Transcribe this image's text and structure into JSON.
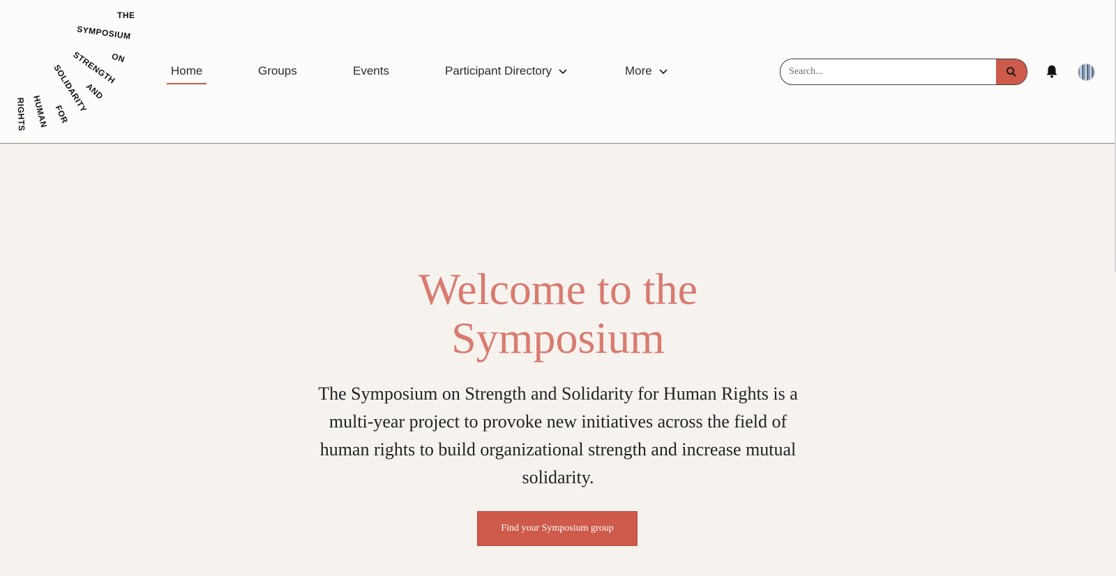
{
  "logo": {
    "words": [
      "THE",
      "SYMPOSIUM",
      "ON",
      "STRENGTH",
      "AND",
      "SOLIDARITY",
      "FOR",
      "HUMAN",
      "RIGHTS"
    ]
  },
  "nav": {
    "items": [
      {
        "label": "Home",
        "active": true
      },
      {
        "label": "Groups"
      },
      {
        "label": "Events"
      },
      {
        "label": "Participant Directory",
        "has_dropdown": true
      },
      {
        "label": "More",
        "has_dropdown": true
      }
    ]
  },
  "search": {
    "placeholder": "Search...",
    "icon": "search-icon"
  },
  "icons": {
    "notifications": "bell-icon",
    "user": "avatar"
  },
  "hero": {
    "title_line1": "Welcome to the",
    "title_line2": "Symposium",
    "description": "The Symposium on Strength and Solidarity for Human Rights is a multi-year project to provoke new initiatives across the field of human rights to build organizational strength and increase mutual solidarity.",
    "cta_label": "Find your Symposium group"
  },
  "colors": {
    "accent": "#cd5a4b",
    "title": "#d97b70",
    "background": "#f6f3ef",
    "header_bg": "#fdfcfb"
  }
}
